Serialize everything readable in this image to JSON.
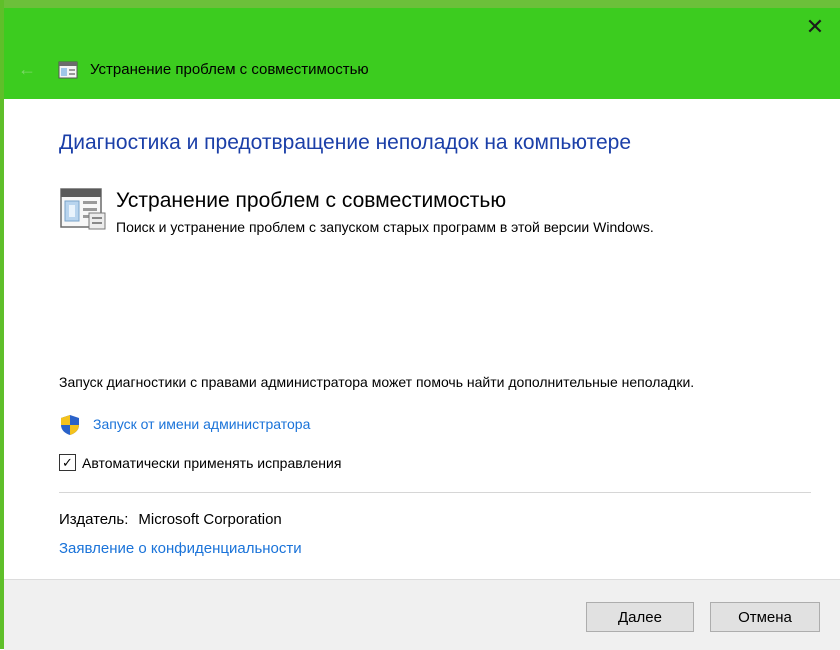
{
  "window": {
    "title": "Устранение проблем с совместимостью",
    "close_icon": "close-icon",
    "back_icon": "back-arrow-icon"
  },
  "main": {
    "heading": "Диагностика и предотвращение неполадок на компьютере",
    "troubleshooter": {
      "title": "Устранение проблем с совместимостью",
      "description": "Поиск и устранение проблем с запуском старых программ в этой версии Windows."
    },
    "admin_note": "Запуск диагностики с правами администратора может помочь найти дополнительные неполадки.",
    "run_as_admin_link": "Запуск от имени администратора",
    "auto_apply": {
      "label": "Автоматически применять исправления",
      "checked": true
    },
    "publisher_label": "Издатель:",
    "publisher_value": "Microsoft Corporation",
    "privacy_link": "Заявление о конфиденциальности"
  },
  "footer": {
    "next_label": "Далее",
    "cancel_label": "Отмена"
  },
  "colors": {
    "titlebar": "#3ccc1f",
    "heading": "#1b3fa8",
    "link": "#1a73d9"
  }
}
